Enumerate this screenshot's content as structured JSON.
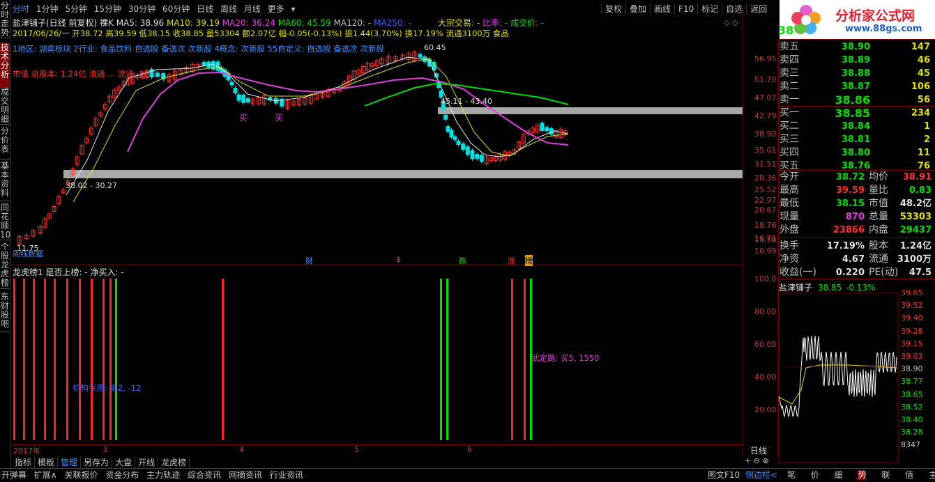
{
  "left_tabs": [
    "分时走势",
    "技术分析",
    "成交明细",
    "分价表",
    "基本资料",
    "同花顺10",
    "个股龙虎榜",
    "东财股吧"
  ],
  "top_menu": [
    "分时",
    "1分钟",
    "5分钟",
    "15分钟",
    "30分钟",
    "60分钟",
    "日线",
    "周线",
    "月线",
    "更多"
  ],
  "toolbar_right": [
    "复权",
    "叠加",
    "画线",
    "F10",
    "标记",
    "自选",
    "返回"
  ],
  "logo": {
    "title": "分析家公式网",
    "url": "www.88gs.com"
  },
  "stock": {
    "name": "盐津铺子",
    "code_partial": "38"
  },
  "chart_header": {
    "title": "盐津铺子(日线 前复权) 裸K",
    "ma5": "MA5: 38.96",
    "ma10": "MA10: 39.19",
    "ma20": "MA20: 36.24",
    "ma60": "MA60: 45.59",
    "ma120": "MA120: -",
    "ma250": "MA250: -",
    "block_trade": "大宗交易: -",
    "ratio": "比率: -",
    "deal_price": "成交价: -",
    "line2": "2017/06/26/一 开38.72 高39.59 低38.15 收38.85 量53304 额2.07亿 幅-0.05(-0.13%) 振1.44(3.70%) 换17.19% 流通3100万 食品",
    "line3": "1地区: 湖南板块  2行业: 食品饮料 自选股 备选次 次新股  4概念: 次新股  55自定义: 自选股 备选次 次新股",
    "line4": "市值 总股本: 1.24亿 流通 ... 流通: 12.0..."
  },
  "chart_annotations": {
    "peak": "60.45",
    "range1": "45.11 - 43.40",
    "range2": "38.02 - 30.27",
    "low": "11.75",
    "buy1": "买",
    "buy2": "买",
    "source": "周线数据",
    "markers": {
      "cai": "财",
      "dollar": "$",
      "die": "跌",
      "zhang": "涨",
      "bang": "榜"
    }
  },
  "price_axis": [
    "56.95",
    "51.70",
    "47.07",
    "42.79",
    "38.90",
    "35.01",
    "31.51",
    "28.36",
    "25.52",
    "22.97",
    "20.67",
    "18.76",
    "16.75",
    "13.56",
    "10.99"
  ],
  "indicator": {
    "title": "龙虎榜1 是否上榜: -  净买入: -",
    "label1": "机构专用: 卖2, -12",
    "label2": "武定路: 买5, 1550",
    "axis": [
      "100.0",
      "80.00",
      "60.00",
      "40.00",
      "20.00"
    ],
    "dates": [
      "2017年",
      "3",
      "4",
      "5",
      "6"
    ]
  },
  "order_book": {
    "asks": [
      {
        "label": "卖五",
        "price": "38.90",
        "vol": "147"
      },
      {
        "label": "卖四",
        "price": "38.89",
        "vol": "46"
      },
      {
        "label": "卖三",
        "price": "38.88",
        "vol": "45"
      },
      {
        "label": "卖二",
        "price": "38.87",
        "vol": "106"
      },
      {
        "label": "卖一",
        "price": "38.86",
        "vol": "56"
      }
    ],
    "bids": [
      {
        "label": "买一",
        "price": "38.85",
        "vol": "234"
      },
      {
        "label": "买二",
        "price": "38.84",
        "vol": "1"
      },
      {
        "label": "买三",
        "price": "38.81",
        "vol": "2"
      },
      {
        "label": "买四",
        "price": "38.80",
        "vol": "11"
      },
      {
        "label": "买五",
        "price": "38.76",
        "vol": "76"
      }
    ]
  },
  "quote": [
    {
      "l1": "今开",
      "v1": "38.72",
      "c1": "#00e000",
      "l2": "均价",
      "v2": "38.91",
      "c2": "#ff3030"
    },
    {
      "l1": "最高",
      "v1": "39.59",
      "c1": "#ff3030",
      "l2": "量比",
      "v2": "0.83",
      "c2": "#00e000"
    },
    {
      "l1": "最低",
      "v1": "38.15",
      "c1": "#00e000",
      "l2": "市值",
      "v2": "48.2亿",
      "c2": "#e0e0e0"
    },
    {
      "l1": "现量",
      "v1": "870",
      "c1": "#e040e0",
      "l2": "总量",
      "v2": "53303",
      "c2": "#e0e000"
    },
    {
      "l1": "外盘",
      "v1": "23866",
      "c1": "#ff3030",
      "l2": "内盘",
      "v2": "29437",
      "c2": "#00e000"
    },
    {
      "l1": "换手",
      "v1": "17.19%",
      "c1": "#e0e0e0",
      "l2": "股本",
      "v2": "1.24亿",
      "c2": "#e0e0e0"
    },
    {
      "l1": "净资",
      "v1": "4.67",
      "c1": "#e0e0e0",
      "l2": "流通",
      "v2": "3100万",
      "c2": "#e0e0e0"
    },
    {
      "l1": "收益(一)",
      "v1": "0.220",
      "c1": "#e0e0e0",
      "l2": "PE(动)",
      "v2": "47.5",
      "c2": "#e0e0e0"
    }
  ],
  "mini_chart": {
    "title": "盐津铺子",
    "price": "38.85",
    "change": "-0.13%",
    "axis": [
      "39.65",
      "39.52",
      "39.40",
      "39.28",
      "39.15",
      "39.03",
      "38.90",
      "38.77",
      "38.65",
      "38.52",
      "38.40",
      "38.28",
      "8347"
    ]
  },
  "sub_tabs": [
    "指标",
    "模板",
    "管理",
    "另存为",
    "大盘",
    "开线",
    "龙虎榜"
  ],
  "period_label": "日线",
  "bottom_bar": [
    "开弹幕",
    "扩展∧",
    "关联报价",
    "资金分布",
    "主力轨迹",
    "综合资讯",
    "网摘资讯",
    "行业资讯"
  ],
  "bottom_right": [
    "图文F10",
    "侧边栏<",
    "笔",
    "价",
    "细",
    "势",
    "联",
    "值",
    "主"
  ]
}
